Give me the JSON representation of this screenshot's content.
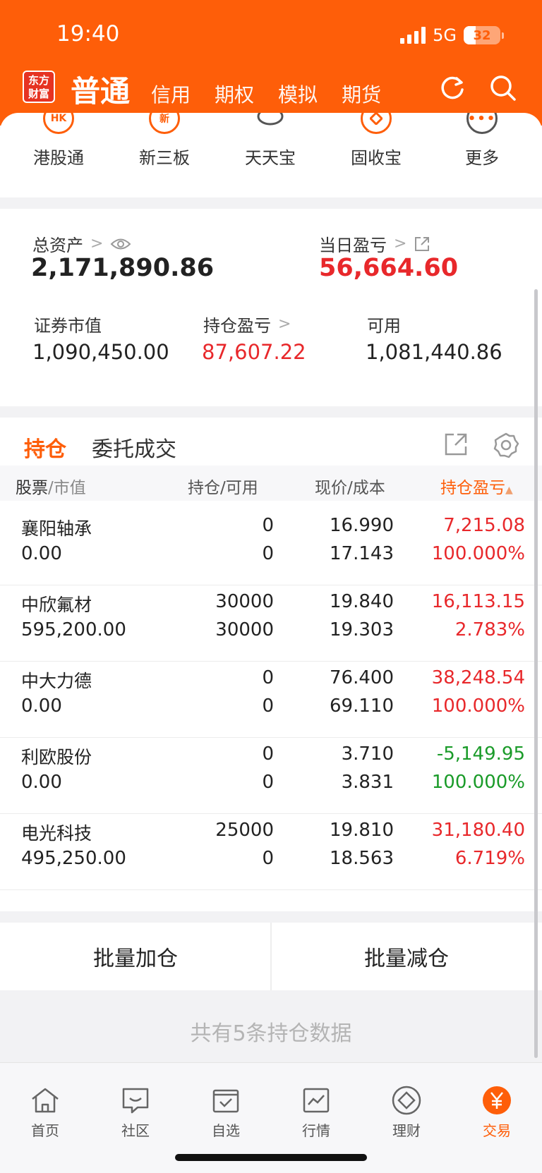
{
  "status_bar": {
    "time": "19:40",
    "network": "5G",
    "battery": "32",
    "battery_level_percent": 32
  },
  "header": {
    "logo_text": "东方财富",
    "tabs": [
      {
        "label": "普通"
      },
      {
        "label": "信用"
      },
      {
        "label": "期权"
      },
      {
        "label": "模拟"
      },
      {
        "label": "期货"
      }
    ],
    "active_color": "#fe5e09"
  },
  "shortcuts": [
    {
      "label": "港股通",
      "icon": "hk-icon",
      "glyph": "HK"
    },
    {
      "label": "新三板",
      "icon": "new-board-icon",
      "glyph": "新"
    },
    {
      "label": "天天宝",
      "icon": "piggy-bank-icon",
      "glyph": ""
    },
    {
      "label": "固收宝",
      "icon": "fixed-income-icon",
      "glyph": ""
    },
    {
      "label": "更多",
      "icon": "more-icon",
      "glyph": ""
    }
  ],
  "assets": {
    "total_label": "总资产",
    "total_value": "2,171,890.86",
    "daily_pl_label": "当日盈亏",
    "daily_pl_value": "56,664.60",
    "market_value_label": "证券市值",
    "market_value": "1,090,450.00",
    "position_pl_label": "持仓盈亏",
    "position_pl_value": "87,607.22",
    "available_label": "可用",
    "available_value": "1,081,440.86"
  },
  "holdings": {
    "tabs": [
      {
        "label": "持仓"
      },
      {
        "label": "委托成交"
      }
    ],
    "columns": {
      "col1a": "股票",
      "col1b": "/市值",
      "col2a": "持仓",
      "col2b": "/可用",
      "col3a": "现价",
      "col3b": "/成本",
      "col4": "持仓盈亏"
    },
    "rows": [
      {
        "name": "襄阳轴承",
        "market_value": "0.00",
        "position": "0",
        "available": "0",
        "price": "16.990",
        "cost": "17.143",
        "pl": "7,215.08",
        "pl_pct": "100.000%",
        "dir": "up"
      },
      {
        "name": "中欣氟材",
        "market_value": "595,200.00",
        "position": "30000",
        "available": "30000",
        "price": "19.840",
        "cost": "19.303",
        "pl": "16,113.15",
        "pl_pct": "2.783%",
        "dir": "up"
      },
      {
        "name": "中大力德",
        "market_value": "0.00",
        "position": "0",
        "available": "0",
        "price": "76.400",
        "cost": "69.110",
        "pl": "38,248.54",
        "pl_pct": "100.000%",
        "dir": "up"
      },
      {
        "name": "利欧股份",
        "market_value": "0.00",
        "position": "0",
        "available": "0",
        "price": "3.710",
        "cost": "3.831",
        "pl": "-5,149.95",
        "pl_pct": "100.000%",
        "dir": "down"
      },
      {
        "name": "电光科技",
        "market_value": "495,250.00",
        "position": "25000",
        "available": "0",
        "price": "19.810",
        "cost": "18.563",
        "pl": "31,180.40",
        "pl_pct": "6.719%",
        "dir": "up"
      }
    ],
    "up_color": "#e8282b",
    "down_color": "#1a9b29"
  },
  "batch": {
    "add_label": "批量加仓",
    "reduce_label": "批量减仓"
  },
  "footer": {
    "summary": "共有5条持仓数据"
  },
  "bottom_nav": [
    {
      "label": "首页",
      "icon": "home-icon"
    },
    {
      "label": "社区",
      "icon": "chat-icon"
    },
    {
      "label": "自选",
      "icon": "checklist-icon"
    },
    {
      "label": "行情",
      "icon": "chart-icon"
    },
    {
      "label": "理财",
      "icon": "diamond-icon"
    },
    {
      "label": "交易",
      "icon": "yuan-icon",
      "active": true
    }
  ]
}
